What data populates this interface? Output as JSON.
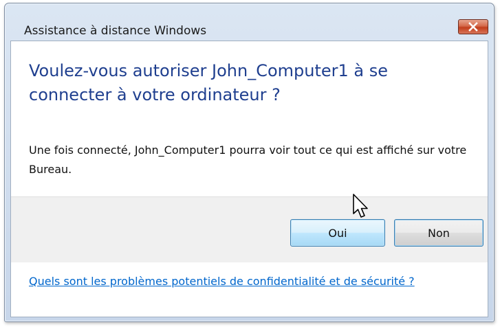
{
  "window": {
    "title": "Assistance à distance Windows",
    "close_icon": "close-icon"
  },
  "dialog": {
    "heading": "Voulez-vous autoriser John_Computer1 à se connecter à votre ordinateur ?",
    "description": "Une fois connecté, John_Computer1 pourra voir tout ce qui est affiché sur votre Bureau.",
    "buttons": {
      "yes_label": "Oui",
      "no_label": "Non"
    },
    "help_link": "Quels sont les problèmes potentiels de confidentialité et de sécurité ?"
  },
  "colors": {
    "heading": "#1f3f8f",
    "link": "#0066cc",
    "close_button": "#c23e1c",
    "button_area": "#f0f0f0"
  },
  "cursor": {
    "icon": "pointer-cursor-icon"
  }
}
